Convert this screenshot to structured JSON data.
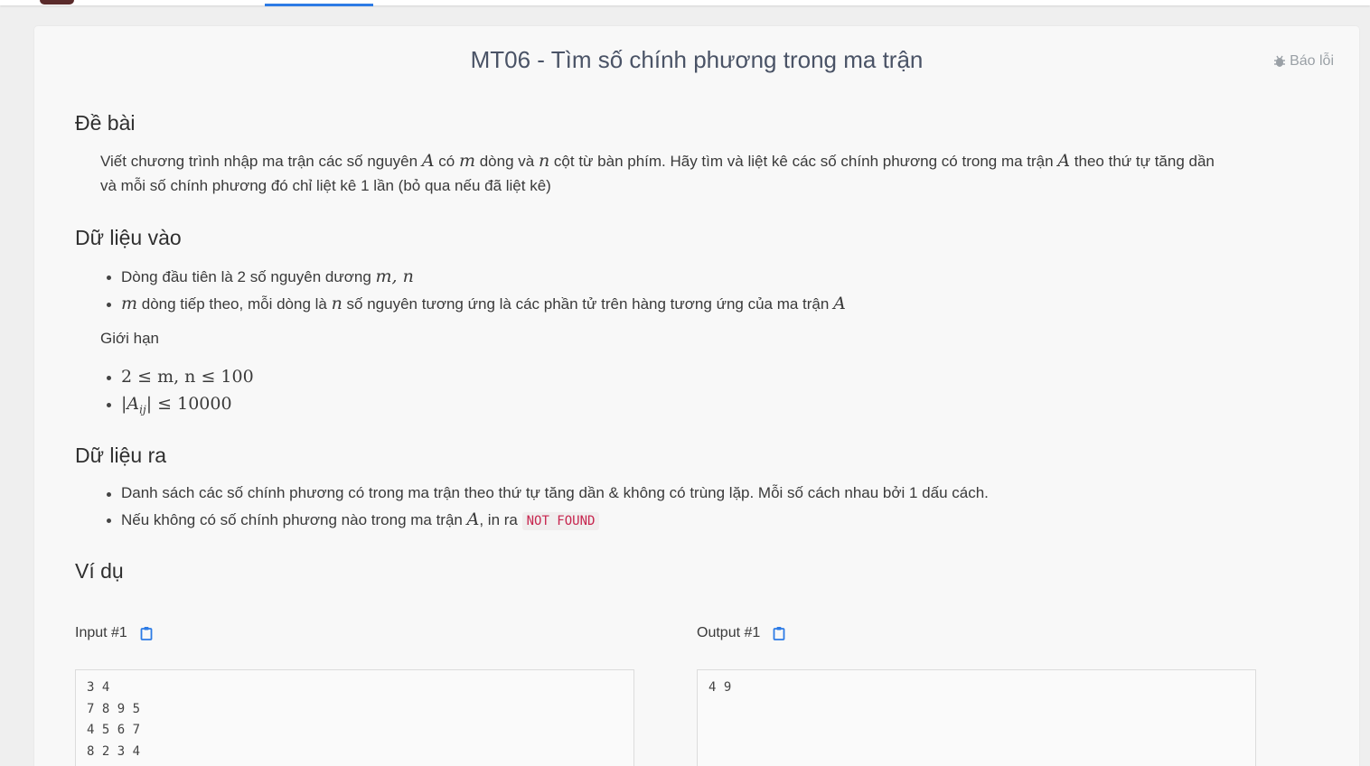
{
  "page": {
    "title": "MT06 - Tìm số chính phương trong ma trận",
    "report_label": "Báo lỗi"
  },
  "sections": {
    "problem": {
      "heading": "Đề bài",
      "text_1": "Viết chương trình nhập ma trận các số nguyên ",
      "var_A": "A",
      "text_2": " có ",
      "var_m": "m",
      "text_3": " dòng và ",
      "var_n": "n",
      "text_4": " cột từ bàn phím. Hãy tìm và liệt kê các số chính phương có trong ma trận ",
      "text_5": " theo thứ tự tăng dần",
      "text_6": "và mỗi số chính phương đó chỉ liệt kê 1 lần (bỏ qua nếu đã liệt kê)"
    },
    "input": {
      "heading": "Dữ liệu vào",
      "item_1_text": "Dòng đầu tiên là 2 số nguyên dương ",
      "item_1_math": "m, n",
      "item_2_math_m": "m",
      "item_2_text_1": " dòng tiếp theo, mỗi dòng là ",
      "item_2_math_n": "n",
      "item_2_text_2": " số nguyên tương ứng là các phần tử trên hàng tương ứng của ma trận ",
      "item_2_math_A": "A",
      "limits_label": "Giới hạn",
      "limit_1": "2 ≤ m, n ≤ 100",
      "limit_2_A": "A",
      "limit_2_sub": "ij",
      "limit_2_rest": "| ≤ 10000"
    },
    "output": {
      "heading": "Dữ liệu ra",
      "item_1": "Danh sách các số chính phương có trong ma trận theo thứ tự tăng dần & không có trùng lặp. Mỗi số cách nhau bởi 1 dấu cách.",
      "item_2_text": "Nếu không có số chính phương nào trong ma trận ",
      "item_2_math": "A",
      "item_2_text_2": ", in ra ",
      "item_2_code": "NOT FOUND"
    },
    "example": {
      "heading": "Ví dụ",
      "input_label": "Input #1",
      "output_label": "Output #1",
      "input_content": "3 4\n7 8 9 5\n4 5 6 7\n8 2 3 4",
      "output_content": "4 9"
    }
  },
  "colors": {
    "accent": "#2d7be5",
    "code_text": "#c7254e",
    "title": "#4a5366"
  },
  "icons": {
    "report": "bug-icon",
    "copy": "clipboard-icon"
  }
}
